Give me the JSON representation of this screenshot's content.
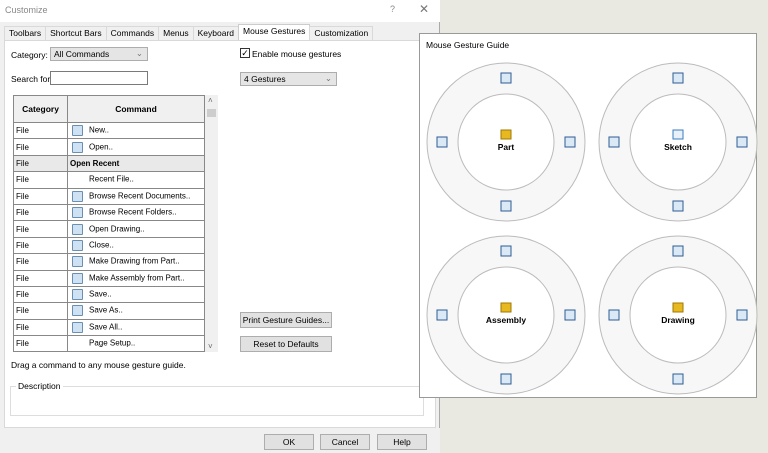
{
  "window": {
    "title": "Customize",
    "help": "?",
    "close": "✕"
  },
  "tabs": [
    "Toolbars",
    "Shortcut Bars",
    "Commands",
    "Menus",
    "Keyboard",
    "Mouse Gestures",
    "Customization"
  ],
  "category": {
    "label": "Category:",
    "value": "All Commands"
  },
  "search": {
    "label": "Search for:",
    "value": ""
  },
  "enable": {
    "label": "Enable mouse gestures",
    "checked": true
  },
  "gestures": {
    "value": "4 Gestures"
  },
  "table": {
    "headers": [
      "Category",
      "Command"
    ],
    "rows": [
      {
        "cat": "File",
        "cmd": "New..",
        "icon": "new-document"
      },
      {
        "cat": "File",
        "cmd": "Open..",
        "icon": "open"
      },
      {
        "cat": "File",
        "cmd": "Open Recent",
        "group": true
      },
      {
        "cat": "File",
        "cmd": "Recent File..",
        "icon": ""
      },
      {
        "cat": "File",
        "cmd": "Browse Recent Documents..",
        "icon": "browse-documents"
      },
      {
        "cat": "File",
        "cmd": "Browse Recent Folders..",
        "icon": "browse-folders"
      },
      {
        "cat": "File",
        "cmd": "Open Drawing..",
        "icon": "open-drawing"
      },
      {
        "cat": "File",
        "cmd": "Close..",
        "icon": "close-document"
      },
      {
        "cat": "File",
        "cmd": "Make Drawing from Part..",
        "icon": "make-drawing"
      },
      {
        "cat": "File",
        "cmd": "Make Assembly from Part..",
        "icon": "make-assembly"
      },
      {
        "cat": "File",
        "cmd": "Save..",
        "icon": "save"
      },
      {
        "cat": "File",
        "cmd": "Save As..",
        "icon": "save-as"
      },
      {
        "cat": "File",
        "cmd": "Save All..",
        "icon": "save-all"
      },
      {
        "cat": "File",
        "cmd": "Page Setup..",
        "icon": ""
      }
    ]
  },
  "buttons": {
    "print": "Print Gesture Guides...",
    "reset": "Reset to Defaults",
    "ok": "OK",
    "cancel": "Cancel",
    "help": "Help"
  },
  "hint": "Drag a command to any mouse gesture guide.",
  "description_label": "Description",
  "guide": {
    "title": "Mouse Gesture Guide",
    "wheels": [
      {
        "label": "Part",
        "icons": [
          "line",
          "view-front",
          "view-right",
          "view-bottom"
        ]
      },
      {
        "label": "Sketch",
        "icons": [
          "smart-dimension",
          "line",
          "edit-sketch",
          "rectangle"
        ]
      },
      {
        "label": "Assembly",
        "icons": [
          "view-top",
          "view-front",
          "view-right",
          "view-bottom"
        ]
      },
      {
        "label": "Drawing",
        "icons": [
          "smart-dimension",
          "weld-symbol",
          "zoom",
          "note"
        ]
      }
    ]
  }
}
